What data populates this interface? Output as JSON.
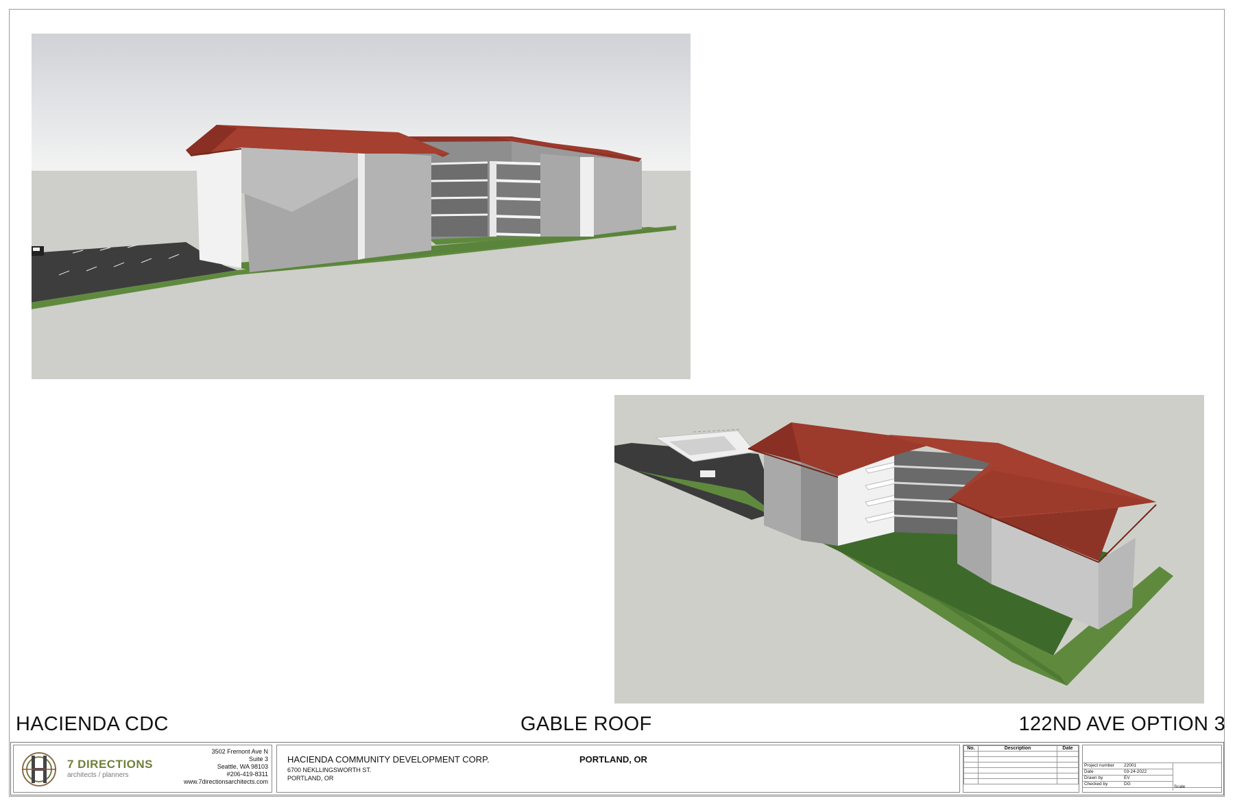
{
  "sheet": {
    "project_name": "HACIENDA CDC",
    "title": "GABLE ROOF",
    "option": "122ND AVE OPTION 3"
  },
  "firm": {
    "name": "7 DIRECTIONS",
    "tagline": "architects / planners",
    "address_lines": [
      "3502 Fremont Ave N",
      "Suite 3",
      "Seattle, WA 98103",
      "#206-419-8311",
      "www.7directionsarchitects.com"
    ]
  },
  "client": {
    "name": "HACIENDA COMMUNITY DEVELOPMENT CORP.",
    "address_line1": "6700 NEKLLINGSWORTH ST.",
    "address_line2": "PORTLAND, OR",
    "city": "PORTLAND, OR"
  },
  "revisions": {
    "headers": [
      "No.",
      "Description",
      "Date"
    ]
  },
  "project_info": {
    "project_number_label": "Project number",
    "project_number": "22001",
    "date_label": "Date",
    "date": "03-24-2022",
    "drawn_by_label": "Drawn by",
    "drawn_by": "EV",
    "checked_by_label": "Checked by",
    "checked_by": "DG",
    "scale_label": "Scale"
  },
  "colors": {
    "roof": "#9c3a2c",
    "wall": "#e6e6e6",
    "lawn": "#5f8a3e",
    "ground": "#cfcfca",
    "asphalt": "#3e3e3e",
    "logo_green": "#6f7f3a"
  }
}
